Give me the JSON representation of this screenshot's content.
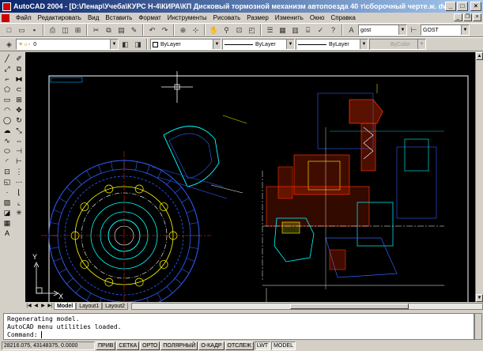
{
  "window": {
    "title": "AutoCAD 2004 - [D:\\Ленар\\Учеба\\КУРС Н-4\\КИРА\\КП Дисковый тормозной механизм автопоезда 40 т\\сборочный черте.ж. dwg]",
    "minimize": "_",
    "maximize": "□",
    "close": "×"
  },
  "menu": {
    "items": [
      "Файл",
      "Редактировать",
      "Вид",
      "Вставить",
      "Формат",
      "Инструменты",
      "Рисовать",
      "Размер",
      "Изменить",
      "Окно",
      "Справка"
    ]
  },
  "toolbar1": {
    "text_style": "gost",
    "dim_style": "GOST"
  },
  "toolbar2": {
    "layer": "0",
    "color": "ByLayer",
    "linetype": "ByLayer",
    "lineweight": "ByLayer",
    "plotstyle": "ByColor"
  },
  "layout_tabs": [
    "Model",
    "Layout1",
    "Layout2"
  ],
  "ucs": {
    "x": "X",
    "y": "Y"
  },
  "command": {
    "lines": [
      "Regenerating model.",
      "AutoCAD menu utilities loaded."
    ],
    "prompt": "Command:"
  },
  "status": {
    "coords": "28216.075, 43148375, 0.0000",
    "buttons": [
      {
        "label": "ПРИВ",
        "on": false
      },
      {
        "label": "СЕТКА",
        "on": false
      },
      {
        "label": "ОРТО",
        "on": false
      },
      {
        "label": "ПОЛЯРНЫЙ",
        "on": false
      },
      {
        "label": "О-КАДР",
        "on": false
      },
      {
        "label": "ОТСЛЕЖ",
        "on": false
      },
      {
        "label": "LWT",
        "on": true
      },
      {
        "label": "MODEL",
        "on": true
      }
    ]
  },
  "colors": {
    "canvas": "#000000",
    "title_start": "#0a246a",
    "title_end": "#a6caf0",
    "geom_cyan": "#00ffff",
    "geom_yellow": "#ffff00",
    "geom_red": "#ff3000",
    "geom_blue": "#3060ff",
    "geom_white": "#ffffff"
  }
}
